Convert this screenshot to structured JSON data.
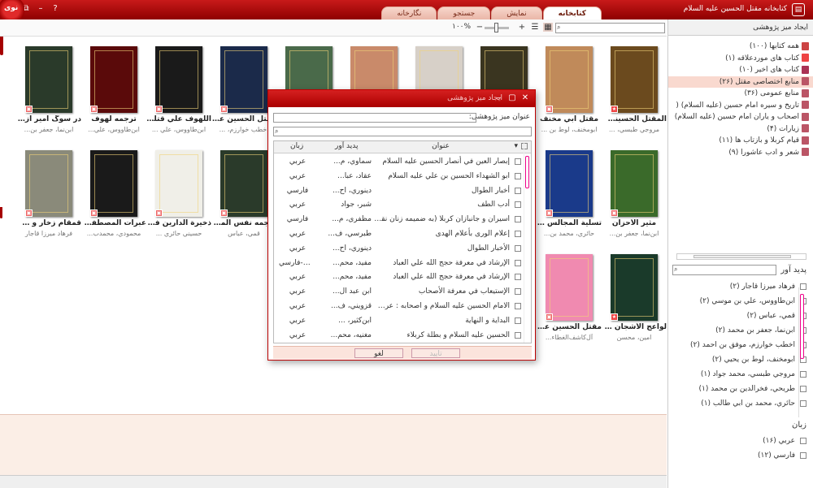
{
  "window": {
    "title": "کتابخانه مقتل الحسین علیه السلام",
    "logo_text": "نوی"
  },
  "tabs": [
    "کتابخانه",
    "نمایش",
    "جستجو",
    "نگارخانه"
  ],
  "toolbar": {
    "zoom": "۱۰۰%"
  },
  "books_row1": [
    {
      "title": "المقتل الحسيني ...",
      "author": "مروجي طبسي، ...",
      "color": "#6b4a1e",
      "badge": "star"
    },
    {
      "title": "مقتل أبي مخنف",
      "author": "ابومخنف، لوط بن ...",
      "color": "#c08a5a",
      "badge": "note"
    },
    {
      "title": "",
      "author": "",
      "color": "#3a3520",
      "badge": "note"
    },
    {
      "title": "",
      "author": "",
      "color": "#d7d0c8",
      "badge": "note"
    },
    {
      "title": "",
      "author": "",
      "color": "#c98a6a",
      "badge": "note"
    },
    {
      "title": "",
      "author": "",
      "color": "#4a6a4a",
      "badge": "note"
    },
    {
      "title": "مقتل الحسين عل...",
      "author": "اخطب خوارزم، ...",
      "color": "#1b2a4a",
      "badge": "note"
    },
    {
      "title": "اللهوف علي قتلي...",
      "author": "ابن‌طاووس، علي ...",
      "color": "#1a1a1a",
      "badge": "note"
    },
    {
      "title": "ترجمه لهوف",
      "author": "ابن‌طاووس، علي...",
      "color": "#5a0a0a",
      "badge": "note"
    },
    {
      "title": "در سوگ امیر آزادی",
      "author": "ابن‌نما، جعفر بن...",
      "color": "#2a3a2a",
      "badge": "note"
    }
  ],
  "books_row2": [
    {
      "title": "مثير الأحزان",
      "author": "ابن‌نما، جعفر بن...",
      "color": "#3a6a2a",
      "badge": "note"
    },
    {
      "title": "تسلية المجالس ...",
      "author": "حائري، محمد بن...",
      "color": "#1a3a8a",
      "badge": "note"
    },
    {
      "title": "",
      "author": "",
      "color": "#b0906a",
      "badge": "note"
    },
    {
      "title": "",
      "author": "",
      "color": "#7a4a2a",
      "badge": "note"
    },
    {
      "title": "",
      "author": "",
      "color": "#2a2a2a",
      "badge": "note"
    },
    {
      "title": "",
      "author": "",
      "color": "#5a4a3a",
      "badge": "note"
    },
    {
      "title": "ترجمه نفس المه...",
      "author": "قمي، عباس",
      "color": "#2a3a2a",
      "badge": "note"
    },
    {
      "title": "ذخيرة الدارين في...",
      "author": "حسيني حائري ...",
      "color": "#f0efe8",
      "badge": "note"
    },
    {
      "title": "عبرات المصطفي...",
      "author": "محمودي، محمدب...",
      "color": "#1a1a1a",
      "badge": "note"
    },
    {
      "title": "قمقام زخار و صم...",
      "author": "فرهاد ميرزا قاجار",
      "color": "#8a8a7a",
      "badge": "note"
    }
  ],
  "books_row3": [
    {
      "title": "لواعج الأشجان ف...",
      "author": "امين، محسن",
      "color": "#1a3a2a",
      "badge": "star"
    },
    {
      "title": "مقتل الحسين عل...",
      "author": "آل‌كاشف‌الغطاء...",
      "color": "#f08ab0",
      "badge": "note"
    }
  ],
  "right_panel": {
    "header": "ایجاد میز پژوهشی",
    "tree": [
      {
        "label": "همه کتابها (۱۰۰)",
        "icon": "book-icon",
        "color": "#c44",
        "selected": false
      },
      {
        "label": "کتاب های موردعلاقه (۱)",
        "icon": "star-icon",
        "color": "#e44",
        "selected": false
      },
      {
        "label": "کتاب های اخیر (۱۰)",
        "icon": "calendar-icon",
        "color": "#a35",
        "selected": false
      },
      {
        "label": "منابع اختصاصی مقتل (۲۶)",
        "icon": "folder-icon",
        "color": "#b56",
        "selected": true
      },
      {
        "label": "منابع عمومی (۳۶)",
        "icon": "folder-icon",
        "color": "#b56",
        "selected": false
      },
      {
        "label": "تاریخ و سیره امام حسین (علیه السلام) (",
        "icon": "folder-icon",
        "color": "#b56",
        "selected": false
      },
      {
        "label": "اصحاب و یاران امام حسین (علیه السلام)",
        "icon": "folder-icon",
        "color": "#b56",
        "selected": false
      },
      {
        "label": "زیارات (۴)",
        "icon": "folder-icon",
        "color": "#b56",
        "selected": false
      },
      {
        "label": "قیام کربلا و بازتاب ها (۱۱)",
        "icon": "folder-icon",
        "color": "#b56",
        "selected": false
      },
      {
        "label": "شعر و ادب عاشورا (۹)",
        "icon": "folder-icon",
        "color": "#b56",
        "selected": false
      }
    ],
    "authors_title": "پدید آور",
    "authors": [
      "فرهاد ميرزا قاجار (۲)",
      "ابن‌طاووس، علي بن موسي (۲)",
      "قمي، عباس (۲)",
      "ابن‌نما، جعفر بن محمد (۲)",
      "اخطب خوارزم، موفق بن احمد (۲)",
      "ابومخنف، لوط بن يحيي (۲)",
      "مروجي طبسي، محمد جواد (۱)",
      "طريحي، فخرالدين بن محمد (۱)",
      "حائري، محمد بن ابي طالب (۱)"
    ],
    "language_title": "زبان",
    "languages": [
      "عربي (۱۶)",
      "فارسي (۱۲)"
    ]
  },
  "dialog": {
    "title": "ایجاد میز پژوهشی",
    "form_label": "عنوان میز پژوهشی:",
    "columns": [
      "عنوان",
      "پدید آور",
      "زبان"
    ],
    "rows": [
      [
        "إبصار العين في أنصار الحسين عليه السلام",
        "سماوي، م...",
        "عربي"
      ],
      [
        "ابو الشهداء الحسين بن علي عليه السلام",
        "عقاد، عبا...",
        "عربي"
      ],
      [
        "أخبار الطوال",
        "دينوري، اح...",
        "فارسي"
      ],
      [
        "أدب الطف",
        "شبر، جواد",
        "عربي"
      ],
      [
        "اسيران و جانبازان كربلا (به ضميمه زنان نقش آ...",
        "مظفري، م...",
        "فارسي"
      ],
      [
        "إعلام الورى بأعلام الهدى",
        "طبرسي، ف...",
        "عربي"
      ],
      [
        "الأخبار الطوال",
        "دينوري، اح...",
        "عربي"
      ],
      [
        "الإرشاد في معرفة حجج الله علي العباد",
        "مفيد، محم...",
        "عربي-فارسي"
      ],
      [
        "الإرشاد في معرفة حجج الله علي العباد",
        "مفيد، محم...",
        "عربي"
      ],
      [
        "الإستيعاب في معرفة الأصحاب",
        "ابن عبد ال...",
        "عربي"
      ],
      [
        "الامام الحسين عليه السلام و اصحابه : عرض تا...",
        "قزويني، ف...",
        "عربي"
      ],
      [
        "البداية و النهاية",
        "ابن‌كثير، ...",
        "عربي"
      ],
      [
        "الحسين عليه السلام و بطلة كربلاء",
        "مغنيه، محم...",
        "عربي"
      ]
    ],
    "ok_label": "تایید",
    "cancel_label": "لغو"
  }
}
